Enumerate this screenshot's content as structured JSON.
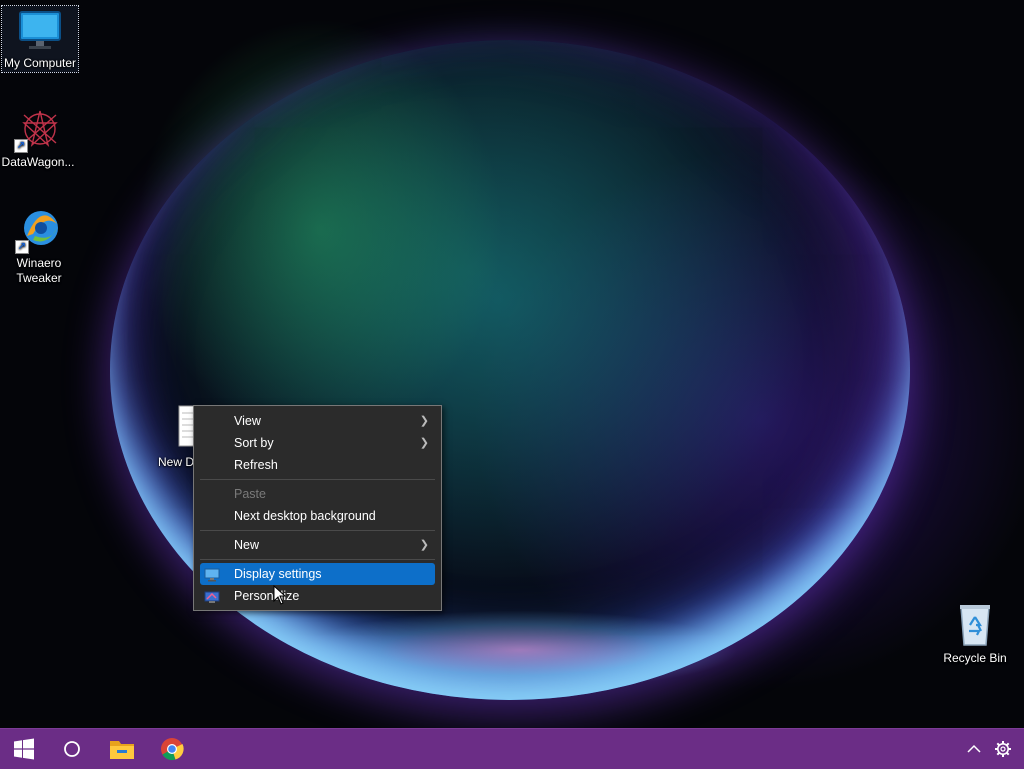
{
  "desktop": {
    "icons": [
      {
        "label": "My Computer"
      },
      {
        "label": "DataWagon..."
      },
      {
        "label": "Winaero Tweaker"
      },
      {
        "label": "New Docum"
      },
      {
        "label": "Recycle Bin"
      }
    ]
  },
  "context_menu": {
    "items": [
      {
        "label": "View",
        "submenu": true
      },
      {
        "label": "Sort by",
        "submenu": true
      },
      {
        "label": "Refresh"
      },
      {
        "label": "Paste",
        "disabled": true
      },
      {
        "label": "Next desktop background"
      },
      {
        "label": "New",
        "submenu": true
      },
      {
        "label": "Display settings",
        "highlighted": true,
        "icon": "display-icon"
      },
      {
        "label": "Personalize",
        "icon": "personalize-icon"
      }
    ]
  },
  "taskbar": {
    "background": "#6b2d86",
    "buttons": [
      {
        "icon": "windows-start-icon"
      },
      {
        "icon": "search-circle-icon"
      },
      {
        "icon": "file-explorer-icon"
      },
      {
        "icon": "chrome-icon"
      }
    ],
    "tray": [
      {
        "icon": "chevron-up-icon"
      },
      {
        "icon": "gear-icon"
      }
    ]
  },
  "colors": {
    "menu_bg": "#2b2b2b",
    "menu_highlight": "#0d6fc9"
  }
}
